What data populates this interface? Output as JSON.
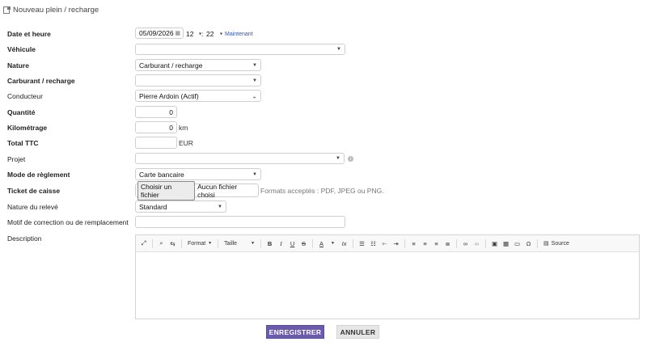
{
  "page": {
    "title": "Nouveau plein / recharge"
  },
  "labels": {
    "date": "Date et heure",
    "vehicule": "Véhicule",
    "nature": "Nature",
    "carburant": "Carburant / recharge",
    "conducteur": "Conducteur",
    "quantite": "Quantité",
    "kilometrage": "Kilométrage",
    "total": "Total TTC",
    "projet": "Projet",
    "reglement": "Mode de règlement",
    "ticket": "Ticket de caisse",
    "nature_releve": "Nature du relevé",
    "motif": "Motif de correction ou de remplacement",
    "description": "Description"
  },
  "fields": {
    "date_value": "05/09/2026",
    "hour_value": "12",
    "minute_value": "22",
    "time_sep": ":",
    "maintenant": "Maintenant",
    "vehicule_value": "",
    "nature_value": "Carburant / recharge",
    "carburant_value": "",
    "conducteur_value": "Pierre Ardoin (Actif)",
    "quantite_value": "0",
    "kilometrage_value": "0",
    "kilometrage_unit": "km",
    "total_value": "",
    "total_unit": "EUR",
    "projet_value": "",
    "reglement_value": "Carte bancaire",
    "file_button": "Choisir un fichier",
    "file_status": "Aucun fichier choisi",
    "file_hint": "Formats acceptés : PDF, JPEG ou PNG.",
    "nature_releve_value": "Standard",
    "motif_value": ""
  },
  "editor": {
    "format_label": "Format",
    "size_label": "Taille",
    "source_label": "Source",
    "icons": [
      "maximize-icon",
      "find-icon",
      "replace-icon",
      "bold-icon",
      "italic-icon",
      "underline-icon",
      "strike-icon",
      "text-color-icon",
      "remove-format-icon",
      "numbered-list-icon",
      "bulleted-list-icon",
      "outdent-icon",
      "indent-icon",
      "align-left-icon",
      "align-center-icon",
      "align-right-icon",
      "justify-icon",
      "link-icon",
      "unlink-icon",
      "image-icon",
      "table-icon",
      "horizontal-rule-icon",
      "special-char-icon",
      "source-icon"
    ]
  },
  "buttons": {
    "save": "ENREGISTRER",
    "cancel": "ANNULER"
  },
  "colors": {
    "primary": "#6a5bab",
    "link": "#3355aa"
  }
}
